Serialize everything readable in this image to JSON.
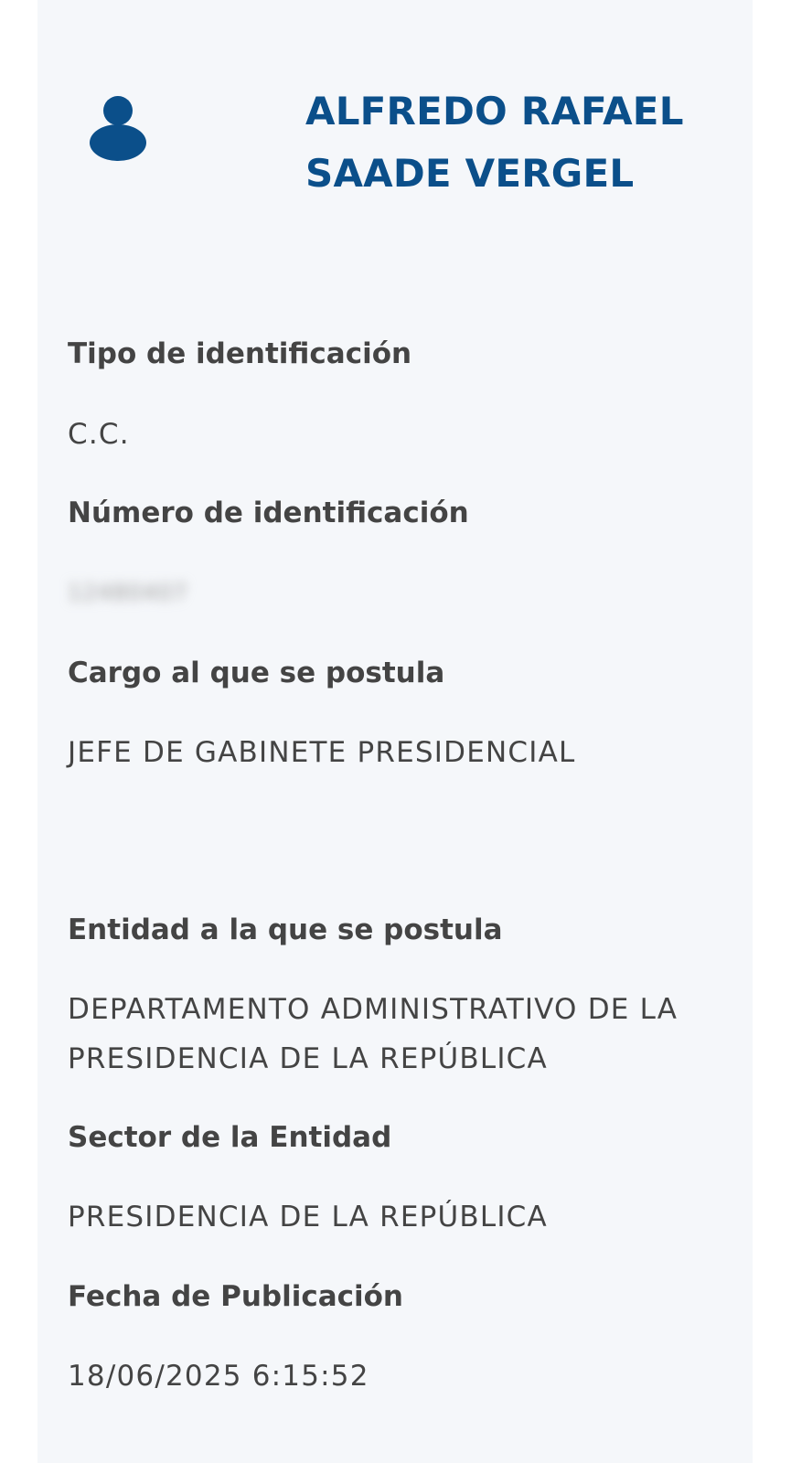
{
  "profile": {
    "icon": "person-icon",
    "icon_color": "#0b4f8a",
    "name_line_1": "ALFREDO RAFAEL",
    "name_line_2": "SAADE VERGEL"
  },
  "fields": {
    "tipo_identificacion": {
      "label": "Tipo de identificación",
      "value": "C.C."
    },
    "numero_identificacion": {
      "label": "Número de identificación",
      "value": "12480407"
    },
    "cargo": {
      "label": "Cargo al que se postula",
      "value": "JEFE DE GABINETE PRESIDENCIAL"
    },
    "entidad": {
      "label": "Entidad a la que se postula",
      "value_line_1": "DEPARTAMENTO ADMINISTRATIVO DE LA",
      "value_line_2": "PRESIDENCIA DE LA REPÚBLICA"
    },
    "sector": {
      "label": "Sector de la Entidad",
      "value": "PRESIDENCIA DE LA REPÚBLICA"
    },
    "fecha_publicacion": {
      "label": "Fecha de Publicación",
      "value": "18/06/2025 6:15:52"
    }
  }
}
